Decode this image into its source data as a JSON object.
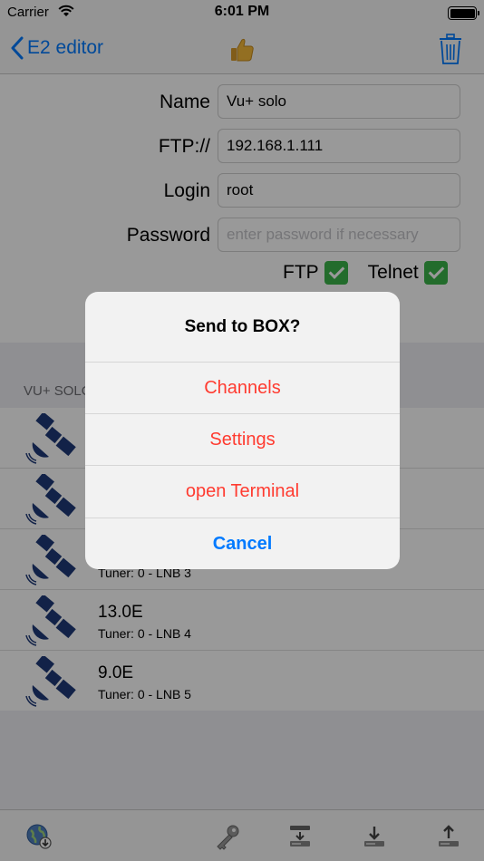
{
  "status_bar": {
    "carrier": "Carrier",
    "time": "6:01 PM"
  },
  "nav": {
    "back_label": "E2 editor"
  },
  "form": {
    "name_label": "Name",
    "name_value": "Vu+ solo",
    "ftp_label": "FTP://",
    "ftp_value": "192.168.1.111",
    "login_label": "Login",
    "login_value": "root",
    "password_label": "Password",
    "password_placeholder": "enter password if necessary",
    "ftp_toggle_label": "FTP",
    "telnet_toggle_label": "Telnet"
  },
  "section": {
    "header": "VU+ SOLO"
  },
  "satellites": [
    {
      "position": "",
      "tuner": ""
    },
    {
      "position": "",
      "tuner": ""
    },
    {
      "position": "",
      "tuner": "Tuner: 0 - LNB 3"
    },
    {
      "position": "13.0E",
      "tuner": "Tuner: 0 - LNB 4"
    },
    {
      "position": "9.0E",
      "tuner": "Tuner: 0 - LNB 5"
    }
  ],
  "alert": {
    "title": "Send to BOX?",
    "actions": [
      "Channels",
      "Settings",
      "open Terminal"
    ],
    "cancel": "Cancel"
  },
  "toolbar": {
    "icons": [
      "globe-download-icon",
      "key-icon",
      "server-transfer-icon",
      "download-icon",
      "upload-icon"
    ]
  },
  "colors": {
    "tint": "#007aff",
    "destructive": "#ff3b30",
    "check": "#3bb54a",
    "satellite": "#1e3a78"
  }
}
